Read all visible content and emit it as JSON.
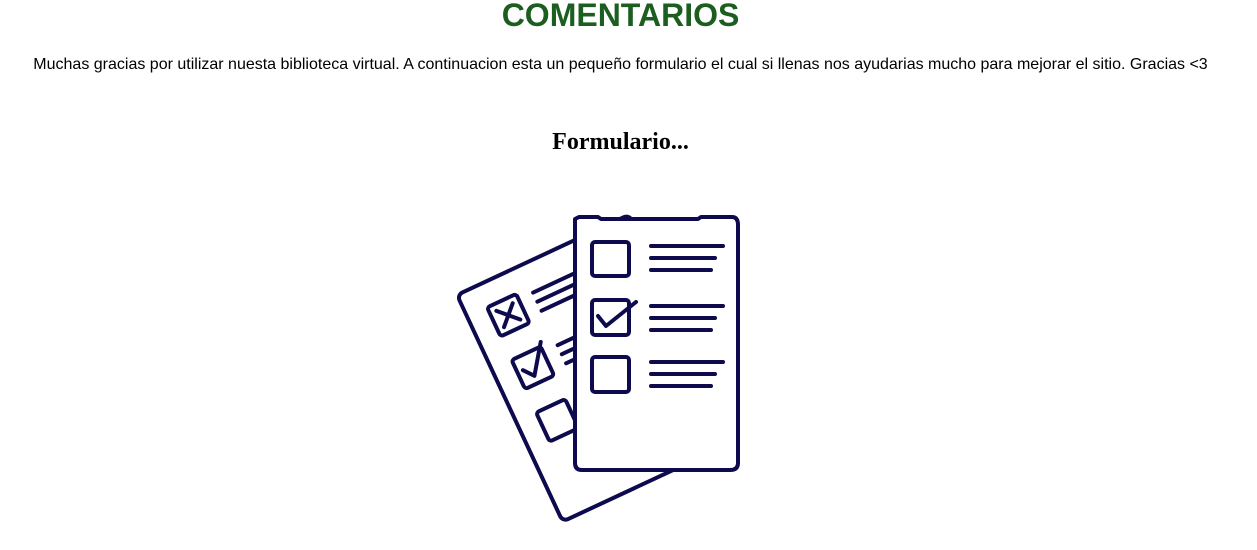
{
  "page": {
    "title": "COMENTARIOS",
    "intro": "Muchas gracias por utilizar nuesta biblioteca virtual. A continuacion esta un pequeño formulario el cual si llenas nos ayudarias mucho para mejorar el sitio. Gracias <3",
    "form_heading": "Formulario..."
  },
  "illustration": {
    "icon": "checklist-forms-icon",
    "stroke_color": "#0d0b4d"
  },
  "colors": {
    "title": "#1b5e20",
    "text": "#000000",
    "background": "#ffffff"
  }
}
